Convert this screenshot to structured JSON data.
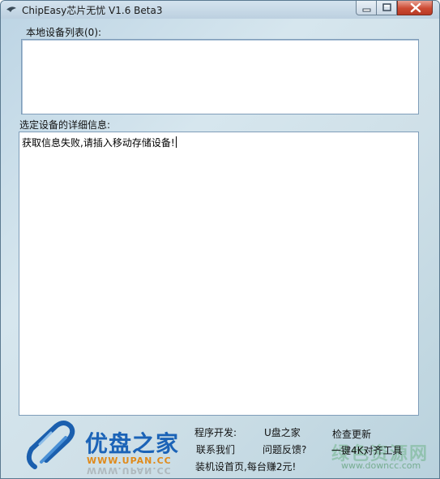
{
  "window": {
    "title": "ChipEasy芯片无忧 V1.6 Beta3"
  },
  "device_list": {
    "label": "本地设备列表(0):",
    "items": []
  },
  "details": {
    "label": "选定设备的详细信息:",
    "text": "获取信息失败,请插入移动存储设备!"
  },
  "footer": {
    "logo_text": "优盘之家",
    "logo_url": "WWW.UPAN.CC",
    "dev_label": "程序开发:",
    "upan_home": "U盘之家",
    "check_update": "检查更新",
    "contact_us": "联系我们",
    "feedback": "问题反馈?",
    "align_tool": "一键4K对齐工具",
    "promo": "装机设首页,每台赚2元!",
    "watermark": "绿色资源网",
    "watermark_url": "www.downcc.com"
  },
  "colors": {
    "logo_blue": "#1b63b7",
    "logo_orange": "#e08a1a",
    "close_red": "#cc4a33"
  }
}
